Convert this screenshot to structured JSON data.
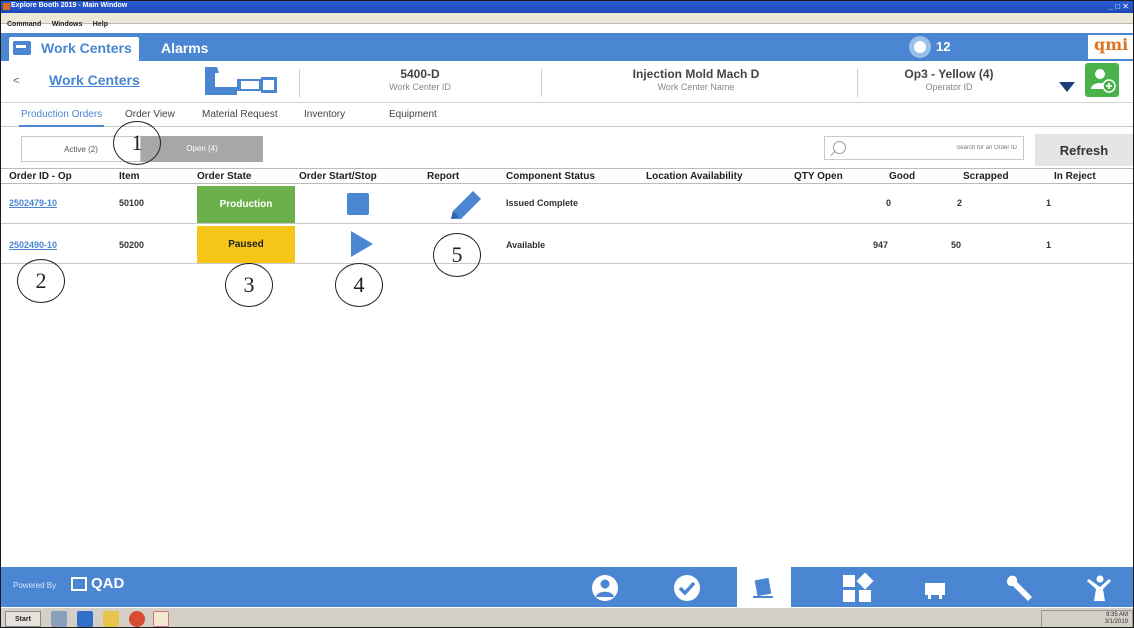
{
  "window": {
    "title": "Explore Booth 2019 - Main Window",
    "menu": [
      "Command",
      "Windows",
      "Help"
    ]
  },
  "topnav": {
    "tabs": [
      "Work Centers",
      "Alarms"
    ],
    "notification_count": "12",
    "logo_text": "qmi"
  },
  "header": {
    "back_label": "<",
    "breadcrumb": "Work Centers",
    "work_center_id": "5400-D",
    "work_center_id_label": "Work Center ID",
    "work_center_name": "Injection Mold Mach D",
    "work_center_name_label": "Work Center Name",
    "operator": "Op3 - Yellow (4)",
    "operator_label": "Operator ID"
  },
  "subtabs": [
    "Production Orders",
    "Order View",
    "Material Request",
    "Inventory",
    "Equipment"
  ],
  "filters": {
    "active_label": "Active (2)",
    "open_label": "Open (4)",
    "search_placeholder": "Search for an Order ID",
    "refresh_label": "Refresh"
  },
  "table": {
    "columns": [
      "Order ID - Op",
      "Item",
      "Order State",
      "Order Start/Stop",
      "Report",
      "Component Status",
      "Location Availability",
      "QTY Open",
      "Good",
      "Scrapped",
      "In Reject"
    ],
    "rows": [
      {
        "order_id": "2502479-10",
        "item": "50100",
        "state": "Production",
        "action": "stop",
        "component_status": "Issued Complete",
        "location_availability": "",
        "qty_open": "",
        "good": "0",
        "scrapped": "2",
        "in_reject": "1"
      },
      {
        "order_id": "2502490-10",
        "item": "50200",
        "state": "Paused",
        "action": "play",
        "component_status": "Available",
        "location_availability": "",
        "qty_open": "947",
        "good": "50",
        "scrapped": "",
        "in_reject": "1"
      }
    ]
  },
  "annotations": [
    "1",
    "2",
    "3",
    "4",
    "5"
  ],
  "footer": {
    "powered_by": "Powered By",
    "brand": "QAD",
    "nav_icons": [
      "user-icon",
      "check-icon",
      "inventory-icon",
      "dashboard-icon",
      "machine-icon",
      "wrench-icon",
      "person-icon"
    ]
  },
  "taskbar": {
    "start_label": "Start",
    "time": "9:35 AM",
    "date": "3/1/2019"
  },
  "colors": {
    "accent_blue": "#4a86d2",
    "production_green": "#6bb04b",
    "paused_yellow": "#f5c518",
    "add_user_green": "#49b24a"
  }
}
